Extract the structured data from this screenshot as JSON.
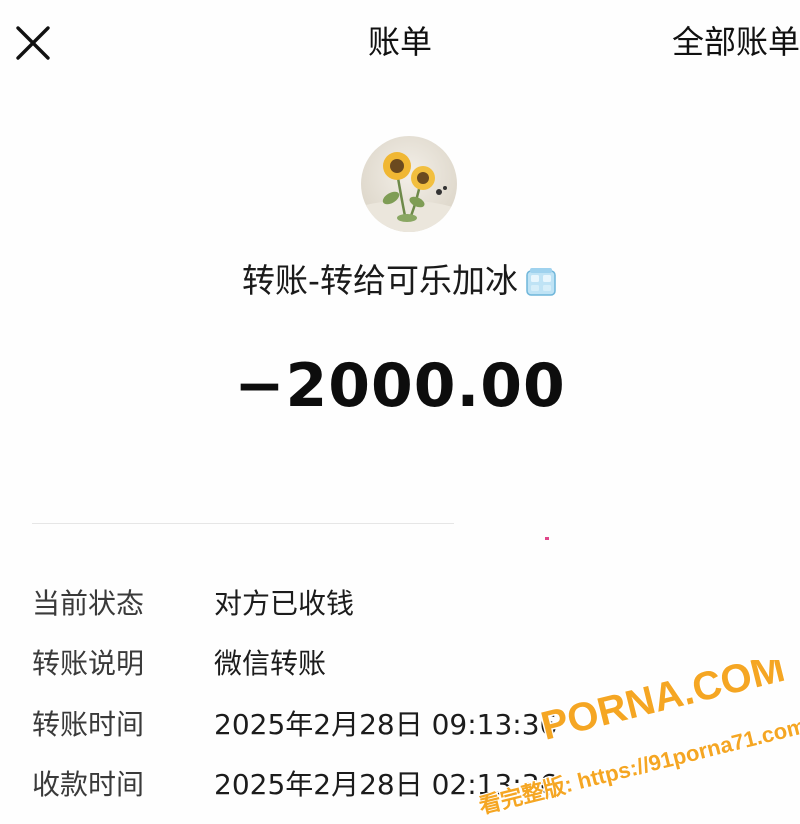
{
  "header": {
    "title": "账单",
    "all_bills_label": "全部账单",
    "close_icon": "close-icon"
  },
  "merchant": {
    "avatar_icon": "sunflower-avatar",
    "name": "转账-转给可乐加冰",
    "emoji_icon": "ice-cube-icon"
  },
  "amount": "−2000.00",
  "details": {
    "rows": [
      {
        "label": "当前状态",
        "value": "对方已收钱"
      },
      {
        "label": "转账说明",
        "value": "微信转账"
      },
      {
        "label": "转账时间",
        "value": "2025年2月28日 09:13:36"
      },
      {
        "label": "收款时间",
        "value": "2025年2月28日 02:13:36"
      }
    ]
  },
  "watermark": {
    "line1": "PORNA.COM",
    "line2": "看完整版: https://91porna71.com",
    "color": "#f5a623"
  },
  "colors": {
    "text": "#111111",
    "label": "#3a3a3a",
    "divider": "#e6e6e6",
    "accent_dot": "#e0468a"
  }
}
